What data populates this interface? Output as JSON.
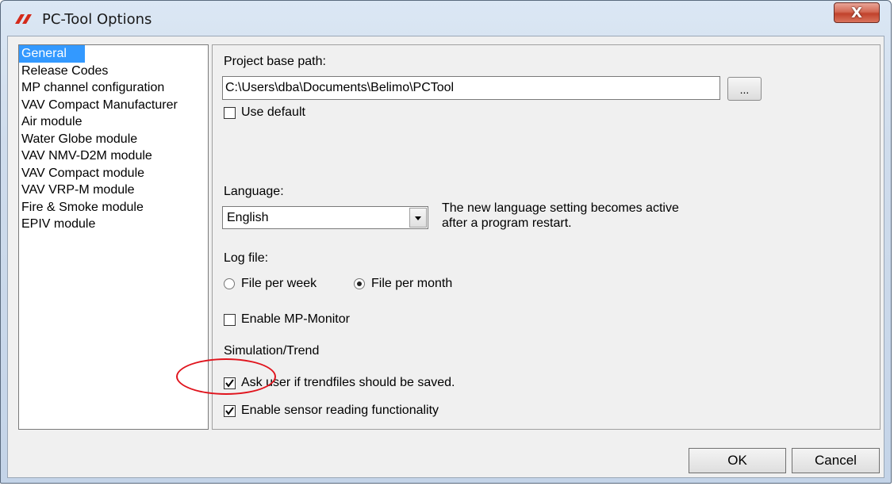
{
  "window": {
    "title": "PC-Tool Options",
    "close_label": "X",
    "logo_color": "#d42a1a"
  },
  "nav": {
    "items": [
      {
        "label": "General",
        "selected": true
      },
      {
        "label": "Release Codes",
        "selected": false
      },
      {
        "label": "MP channel configuration",
        "selected": false
      },
      {
        "label": "VAV Compact Manufacturer",
        "selected": false
      },
      {
        "label": "Air module",
        "selected": false
      },
      {
        "label": "Water Globe module",
        "selected": false
      },
      {
        "label": "VAV NMV-D2M module",
        "selected": false
      },
      {
        "label": "VAV Compact module",
        "selected": false
      },
      {
        "label": "VAV VRP-M module",
        "selected": false
      },
      {
        "label": "Fire & Smoke module",
        "selected": false
      },
      {
        "label": "EPIV module",
        "selected": false
      }
    ]
  },
  "general": {
    "project_path_label": "Project base path:",
    "project_path_value": "C:\\Users\\dba\\Documents\\Belimo\\PCTool",
    "browse_label": "...",
    "use_default_label": "Use default",
    "use_default_checked": false,
    "language_label": "Language:",
    "language_value": "English",
    "language_note_line1": "The new language setting becomes active",
    "language_note_line2": "after a program restart.",
    "logfile_label": "Log file:",
    "logfile_options": [
      {
        "label": "File per week",
        "selected": false
      },
      {
        "label": "File per month",
        "selected": true
      }
    ],
    "enable_mp_monitor_label": "Enable MP-Monitor",
    "enable_mp_monitor_checked": false,
    "simulation_label": "Simulation/Trend",
    "ask_trendfiles_label": "Ask user if trendfiles should be saved.",
    "ask_trendfiles_checked": true,
    "enable_sensor_label": "Enable sensor reading functionality",
    "enable_sensor_checked": true
  },
  "footer": {
    "ok_label": "OK",
    "cancel_label": "Cancel"
  },
  "annotation": {
    "color": "#e0141d"
  }
}
